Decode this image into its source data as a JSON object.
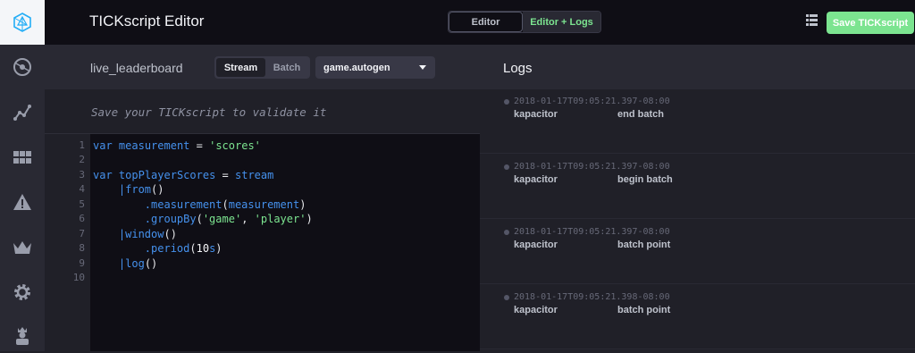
{
  "header": {
    "title": "TICKscript Editor",
    "view_toggle": {
      "editor": "Editor",
      "editor_logs": "Editor + Logs"
    },
    "save_button": "Save TICKscript"
  },
  "editor": {
    "script_name": "live_leaderboard",
    "type_toggle": {
      "stream": "Stream",
      "batch": "Batch",
      "selected": "Stream"
    },
    "database": "game.autogen",
    "validation_message": "Save your TICKscript to validate it",
    "line_numbers": [
      "1",
      "2",
      "3",
      "4",
      "5",
      "6",
      "7",
      "8",
      "9",
      "10"
    ]
  },
  "logs": {
    "title": "Logs",
    "entries": [
      {
        "timestamp": "2018-01-17T09:05:21.397-08:00",
        "service": "kapacitor",
        "message": "end batch"
      },
      {
        "timestamp": "2018-01-17T09:05:21.397-08:00",
        "service": "kapacitor",
        "message": "begin batch"
      },
      {
        "timestamp": "2018-01-17T09:05:21.397-08:00",
        "service": "kapacitor",
        "message": "batch point"
      },
      {
        "timestamp": "2018-01-17T09:05:21.398-08:00",
        "service": "kapacitor",
        "message": "batch point"
      }
    ]
  },
  "icons": {
    "logo": "chronograf-logo-icon",
    "nav": [
      "dashboard-graph-icon",
      "graph-icon",
      "table-grid-icon",
      "alert-triangle-icon",
      "crown-icon",
      "gear-icon",
      "user-icon"
    ],
    "list": "list-icon"
  },
  "colors": {
    "accent_green": "#7ce490",
    "accent_blue": "#4591ed"
  }
}
